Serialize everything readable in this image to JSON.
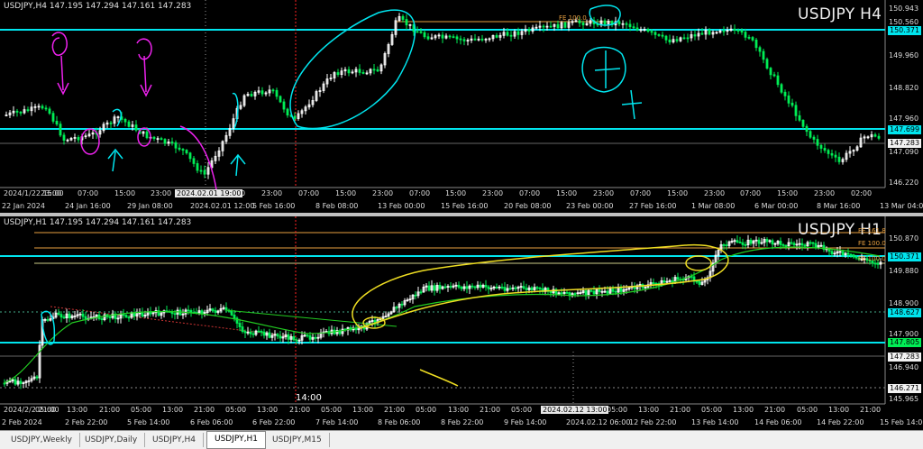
{
  "top": {
    "info": "USDJPY,H4  147.195 147.294 147.161 147.283",
    "title": "USDJPY H4",
    "fe_label": "FE 100.0",
    "prices": [
      "150.943",
      "150.560",
      "149.960",
      "148.820",
      "147.960",
      "147.090",
      "146.220"
    ],
    "price_hl": {
      "cyan1": "150.371",
      "cyan2": "147.699",
      "white": "147.283"
    },
    "times": [
      "2024/1/22 15:00",
      "23:00",
      "07:00",
      "15:00",
      "23:00",
      "07:00",
      "15:00",
      "23:00",
      "07:00",
      "15:00",
      "23:00",
      "07:00",
      "15:00",
      "23:00",
      "07:00",
      "15:00",
      "23:00",
      "07:00",
      "15:00",
      "23:00",
      "07:00",
      "15:00",
      "23:00",
      "02:00"
    ],
    "time_box": "2024.02.01 19:00",
    "dates": [
      "22 Jan 2024",
      "24 Jan 16:00",
      "29 Jan 08:00",
      "2024.02.01 12:00",
      "5 Feb 16:00",
      "8 Feb 08:00",
      "13 Feb 00:00",
      "15 Feb 16:00",
      "20 Feb 08:00",
      "23 Feb 00:00",
      "27 Feb 16:00",
      "1 Mar 08:00",
      "6 Mar 00:00",
      "8 Mar 16:00",
      "13 Mar 04:00"
    ]
  },
  "bottom": {
    "info": "USDJPY,H1  147.195 147.294 147.161 147.283",
    "title": "USDJPY H1",
    "fe_labels": [
      "FE 161.8",
      "FE 100.0",
      "FE 100.0"
    ],
    "prices": [
      "150.870",
      "149.880",
      "148.900",
      "147.900",
      "146.940",
      "145.965"
    ],
    "price_hl": {
      "cyan1": "150.371",
      "cyan2": "148.627",
      "green": "147.805",
      "white": "147.283",
      "white2": "146.271"
    },
    "cross_time": "14:00",
    "times": [
      "2024/2/2 21:00",
      "05:00",
      "13:00",
      "21:00",
      "05:00",
      "13:00",
      "21:00",
      "05:00",
      "13:00",
      "21:00",
      "05:00",
      "13:00",
      "21:00",
      "05:00",
      "13:00",
      "21:00",
      "05:00",
      "13:00",
      "21:00",
      "05:00",
      "13:00",
      "21:00",
      "05:00",
      "13:00",
      "21:00",
      "05:00",
      "13:00",
      "21:00"
    ],
    "time_box": "2024.02.12 13:00",
    "dates": [
      "2 Feb 2024",
      "2 Feb 22:00",
      "5 Feb 14:00",
      "6 Feb 06:00",
      "6 Feb 22:00",
      "7 Feb 14:00",
      "8 Feb 06:00",
      "8 Feb 22:00",
      "9 Feb 14:00",
      "2024.02.12 06:00",
      "12 Feb 22:00",
      "13 Feb 14:00",
      "14 Feb 06:00",
      "14 Feb 22:00",
      "15 Feb 14:00"
    ]
  },
  "tabs": [
    "USDJPY,Weekly",
    "USDJPY,Daily",
    "USDJPY,H4",
    "USDJPY,H1",
    "USDJPY,M15"
  ],
  "active_tab": "USDJPY,H1",
  "colors": {
    "cyan": "#00e5ee",
    "bull": "#ffffff",
    "bear": "#00ee55",
    "ma": "#22cc22",
    "pen_magenta": "#ee22ee",
    "pen_yellow": "#eedd22",
    "crosshair": "#ff2222"
  }
}
